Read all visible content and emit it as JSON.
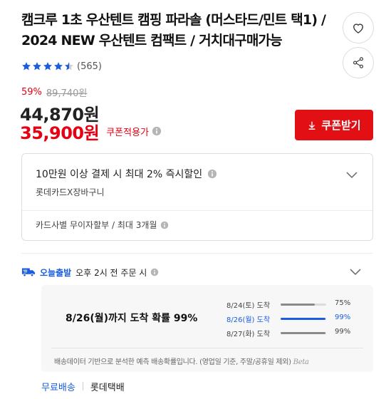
{
  "product": {
    "title": "캠크루 1초 우산텐트 캠핑 파라솔 (머스타드/민트 택1) / 2024 NEW 우산텐트 컴팩트 / 거치대구매가능",
    "rating_stars": 4.5,
    "review_count": "(565)"
  },
  "price": {
    "discount_rate": "59%",
    "original_price": "89,740원",
    "sale_price": "44,870원",
    "coupon_price": "35,900원",
    "coupon_label": "쿠폰적용가"
  },
  "coupon_button": {
    "label": "쿠폰받기"
  },
  "card_benefit": {
    "title": "10만원 이상 결제 시 최대 2% 즉시할인",
    "subtitle": "롯데카드X장바구니",
    "installment": "카드사별 무이자할부 / 최대 3개월"
  },
  "delivery": {
    "badge": "오늘출발",
    "cutoff": "오후 2시 전 주문 시",
    "main_text": "8/26(월)까지 도착 확률 99%",
    "probabilities": [
      {
        "date": "8/24(토) 도착",
        "percent": "75%",
        "value": 75,
        "highlight": false
      },
      {
        "date": "8/26(월) 도착",
        "percent": "99%",
        "value": 99,
        "highlight": true
      },
      {
        "date": "8/27(화) 도착",
        "percent": "99%",
        "value": 99,
        "highlight": false
      }
    ],
    "note": "배송데이터 기반으로 분석한 예측 배송확률입니다. (영업일 기준, 주말/공휴일 제외)",
    "beta_label": "Beta"
  },
  "shipping": {
    "fee": "무료배송",
    "carrier": "롯데택배"
  },
  "colors": {
    "accent_red": "#e20f14",
    "accent_blue": "#1a5de0",
    "star_blue": "#1a5de0"
  },
  "icons": {
    "wishlist": "heart-icon",
    "share": "share-icon",
    "download": "download-icon",
    "info": "info-icon",
    "chevron": "chevron-down-icon",
    "truck": "truck-icon"
  }
}
